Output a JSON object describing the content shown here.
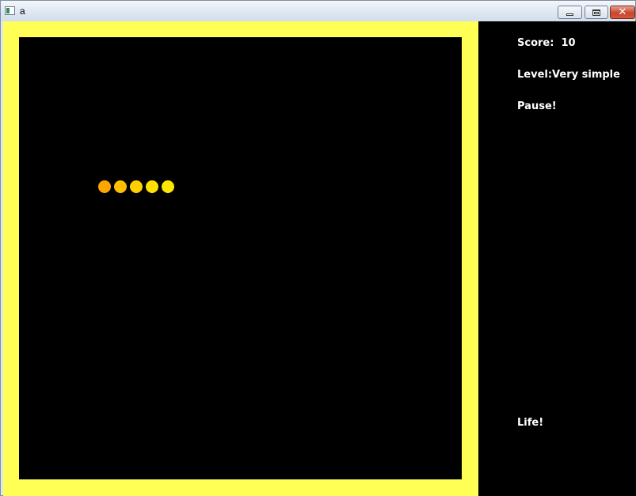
{
  "window": {
    "title": "a",
    "icons": {
      "app": "app-window-icon",
      "minimize": "minimize-icon",
      "maximize": "restore-icon",
      "close": "close-icon",
      "close_glyph": "✕"
    }
  },
  "game": {
    "border_color": "#ffff55",
    "board_color": "#000000",
    "snake": [
      {
        "color": "#ffa500"
      },
      {
        "color": "#ffc000"
      },
      {
        "color": "#ffd000"
      },
      {
        "color": "#ffe000"
      },
      {
        "color": "#ffe500"
      }
    ]
  },
  "sidebar": {
    "score": "Score:  10",
    "level": "Level:Very simple",
    "status": "Pause!",
    "life": "Life!"
  }
}
